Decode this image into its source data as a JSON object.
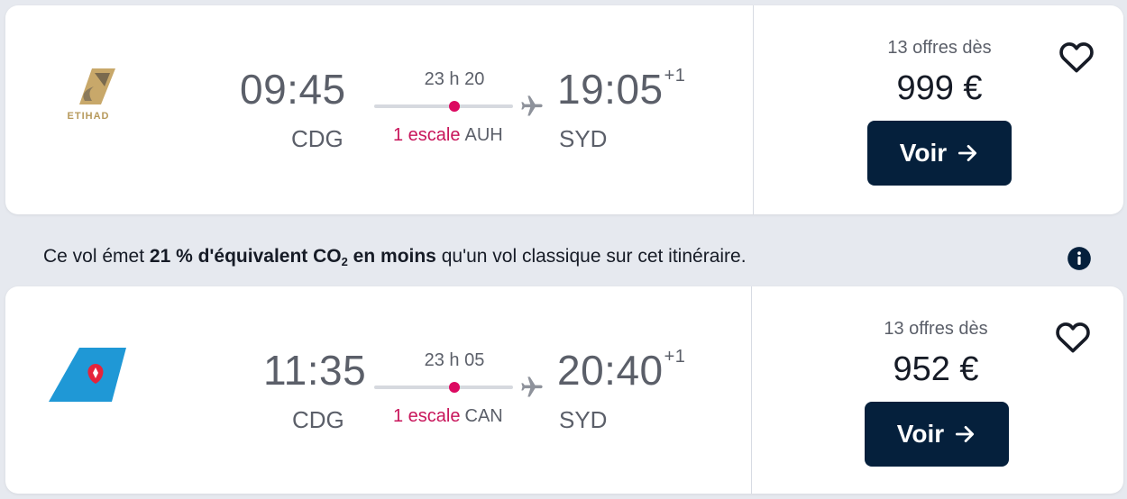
{
  "results": [
    {
      "airline": "ETIHAD",
      "departure_time": "09:45",
      "departure_airport": "CDG",
      "duration": "23 h 20",
      "stops_label": "1 escale",
      "stop_airport": "AUH",
      "arrival_time": "19:05",
      "arrival_day_offset": "+1",
      "arrival_airport": "SYD",
      "offers_label": "13 offres dès",
      "price": "999 €",
      "button_label": "Voir"
    },
    {
      "airline": "China Southern",
      "departure_time": "11:35",
      "departure_airport": "CDG",
      "duration": "23 h 05",
      "stops_label": "1 escale",
      "stop_airport": "CAN",
      "arrival_time": "20:40",
      "arrival_day_offset": "+1",
      "arrival_airport": "SYD",
      "offers_label": "13 offres dès",
      "price": "952 €",
      "button_label": "Voir"
    }
  ],
  "eco_banner": {
    "prefix": "Ce vol émet ",
    "highlight_start": "21 % d'équivalent CO",
    "subscript": "2",
    "highlight_end": " en moins",
    "suffix": " qu'un vol classique sur cet itinéraire."
  },
  "colors": {
    "primary_button": "#05203c",
    "stop_accent": "#dc0a61",
    "background": "#e6e9ef"
  },
  "icons": [
    "airline-logo",
    "plane-icon",
    "heart-icon",
    "arrow-right-icon",
    "info-icon"
  ]
}
